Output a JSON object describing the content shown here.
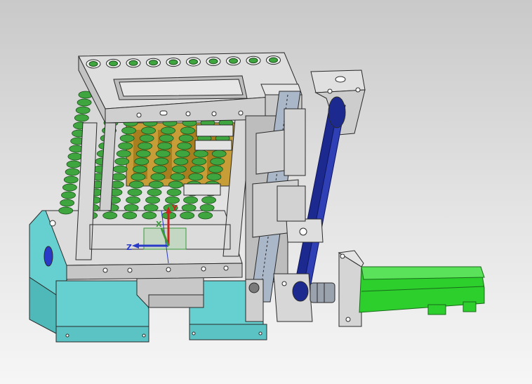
{
  "viewport": {
    "background_top": "#c9c9c9",
    "background_bottom": "#f6f6f6"
  },
  "model": {
    "frame_color": "#d7d7d7",
    "screw_color": "#3fa63f",
    "base_color": "#66cfcf",
    "belt_color": "#1c2a8f",
    "motor_color": "#2ccf2c",
    "brass_color": "#c59a2e",
    "outline_color": "#2a2a2a"
  },
  "triad": {
    "x_label": "X",
    "y_label": "Y",
    "z_label": "Z",
    "x_color": "#3a9a3a",
    "y_color": "#d02020",
    "z_color": "#2a3ac8"
  }
}
